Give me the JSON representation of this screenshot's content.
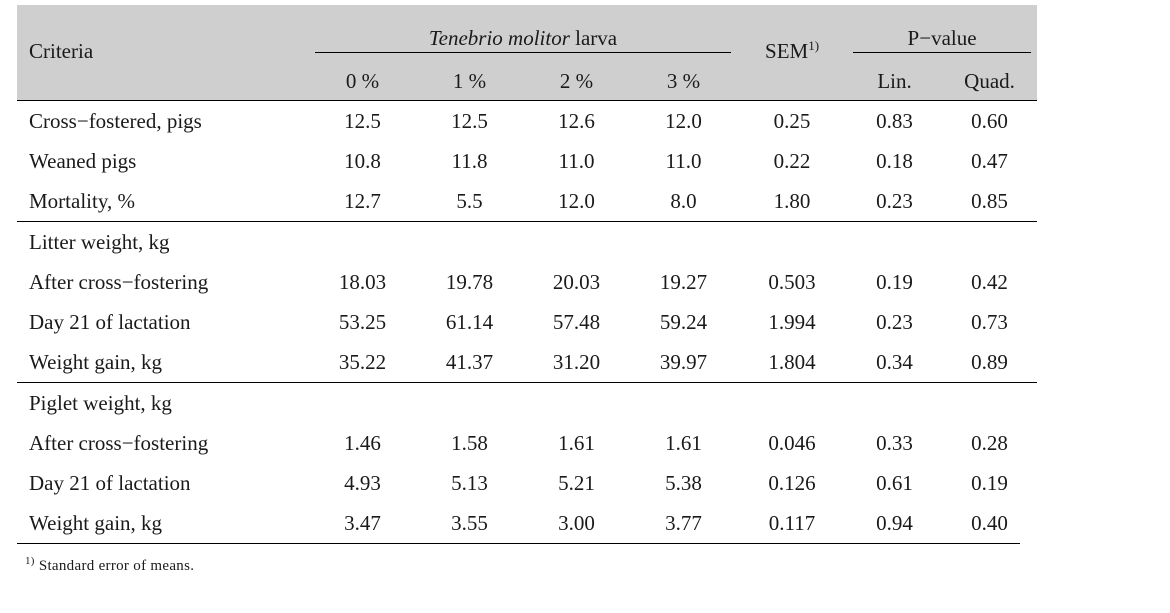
{
  "table": {
    "header": {
      "criteria_label": "Criteria",
      "group_label_italic": "Tenebrio molitor",
      "group_label_rest": " larva",
      "sem_label": "SEM",
      "sem_superscript": "1)",
      "pvalue_label": "P−value",
      "dose_levels": [
        "0 %",
        "1 %",
        "2 %",
        "3 %"
      ],
      "pvalue_subheads": [
        "Lin.",
        "Quad."
      ]
    },
    "sections": [
      {
        "rows": [
          {
            "criteria": "Cross−fostered, pigs",
            "values": [
              "12.5",
              "12.5",
              "12.6",
              "12.0"
            ],
            "sem": "0.25",
            "lin": "0.83",
            "quad": "0.60"
          },
          {
            "criteria": "Weaned pigs",
            "values": [
              "10.8",
              "11.8",
              "11.0",
              "11.0"
            ],
            "sem": "0.22",
            "lin": "0.18",
            "quad": "0.47"
          },
          {
            "criteria": "Mortality, %",
            "values": [
              "12.7",
              "5.5",
              "12.0",
              "8.0"
            ],
            "sem": "1.80",
            "lin": "0.23",
            "quad": "0.85"
          }
        ]
      },
      {
        "rows": [
          {
            "criteria": "Litter weight, kg",
            "values": [
              "",
              "",
              "",
              ""
            ],
            "sem": "",
            "lin": "",
            "quad": ""
          },
          {
            "criteria": "After cross−fostering",
            "values": [
              "18.03",
              "19.78",
              "20.03",
              "19.27"
            ],
            "sem": "0.503",
            "lin": "0.19",
            "quad": "0.42"
          },
          {
            "criteria": "Day 21 of lactation",
            "values": [
              "53.25",
              "61.14",
              "57.48",
              "59.24"
            ],
            "sem": "1.994",
            "lin": "0.23",
            "quad": "0.73"
          },
          {
            "criteria": "Weight gain, kg",
            "values": [
              "35.22",
              "41.37",
              "31.20",
              "39.97"
            ],
            "sem": "1.804",
            "lin": "0.34",
            "quad": "0.89"
          }
        ]
      },
      {
        "rows": [
          {
            "criteria": "Piglet weight, kg",
            "values": [
              "",
              "",
              "",
              ""
            ],
            "sem": "",
            "lin": "",
            "quad": ""
          },
          {
            "criteria": "After cross−fostering",
            "values": [
              "1.46",
              "1.58",
              "1.61",
              "1.61"
            ],
            "sem": "0.046",
            "lin": "0.33",
            "quad": "0.28"
          },
          {
            "criteria": "Day 21 of lactation",
            "values": [
              "4.93",
              "5.13",
              "5.21",
              "5.38"
            ],
            "sem": "0.126",
            "lin": "0.61",
            "quad": "0.19"
          },
          {
            "criteria": "Weight gain, kg",
            "values": [
              "3.47",
              "3.55",
              "3.00",
              "3.77"
            ],
            "sem": "0.117",
            "lin": "0.94",
            "quad": "0.40"
          }
        ]
      }
    ],
    "footnote": {
      "marker": "1)",
      "text": " Standard error of means."
    }
  },
  "colors": {
    "header_background": "#cfcfcf",
    "rule": "#000000",
    "text": "#1a1a1a",
    "page_background": "#ffffff"
  }
}
